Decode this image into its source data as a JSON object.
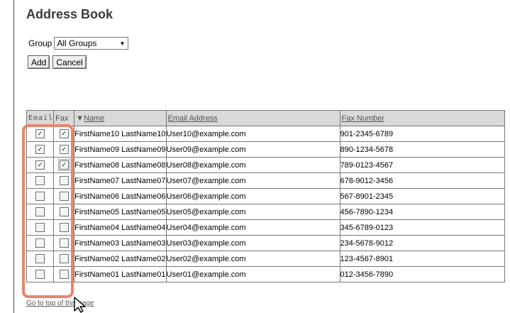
{
  "page": {
    "title": "Address Book"
  },
  "group": {
    "label": "Group",
    "selected": "All Groups"
  },
  "buttons": {
    "add": "Add",
    "cancel": "Cancel"
  },
  "table": {
    "headers": {
      "email": "Email",
      "fax": "Fax",
      "name": "Name",
      "email_address": "Email Address",
      "fax_number": "Fax Number"
    },
    "sort_indicator": "▼",
    "rows": [
      {
        "email_checked": true,
        "fax_checked": true,
        "name": "FirstName10 LastName10",
        "email": "User10@example.com",
        "fax": "901-2345-6789"
      },
      {
        "email_checked": true,
        "fax_checked": true,
        "name": "FirstName09 LastName09",
        "email": "User09@example.com",
        "fax": "890-1234-5678"
      },
      {
        "email_checked": true,
        "fax_checked": true,
        "name": "FirstName08 LastName08",
        "email": "User08@example.com",
        "fax": "789-0123-4567"
      },
      {
        "email_checked": false,
        "fax_checked": false,
        "name": "FirstName07 LastName07",
        "email": "User07@example.com",
        "fax": "678-9012-3456"
      },
      {
        "email_checked": false,
        "fax_checked": false,
        "name": "FirstName06 LastName06",
        "email": "User06@example.com",
        "fax": "567-8901-2345"
      },
      {
        "email_checked": false,
        "fax_checked": false,
        "name": "FirstName05 LastName05",
        "email": "User05@example.com",
        "fax": "456-7890-1234"
      },
      {
        "email_checked": false,
        "fax_checked": false,
        "name": "FirstName04 LastName04",
        "email": "User04@example.com",
        "fax": "345-6789-0123"
      },
      {
        "email_checked": false,
        "fax_checked": false,
        "name": "FirstName03 LastName03",
        "email": "User03@example.com",
        "fax": "234-5678-9012"
      },
      {
        "email_checked": false,
        "fax_checked": false,
        "name": "FirstName02 LastName02",
        "email": "User02@example.com",
        "fax": "123-4567-8901"
      },
      {
        "email_checked": false,
        "fax_checked": false,
        "name": "FirstName01 LastName01",
        "email": "User01@example.com",
        "fax": "012-3456-7890"
      }
    ]
  },
  "footer": {
    "top_link": "Go to top of this page"
  },
  "colors": {
    "highlight": "#e8866e",
    "header_bg": "#d9d9d9"
  }
}
